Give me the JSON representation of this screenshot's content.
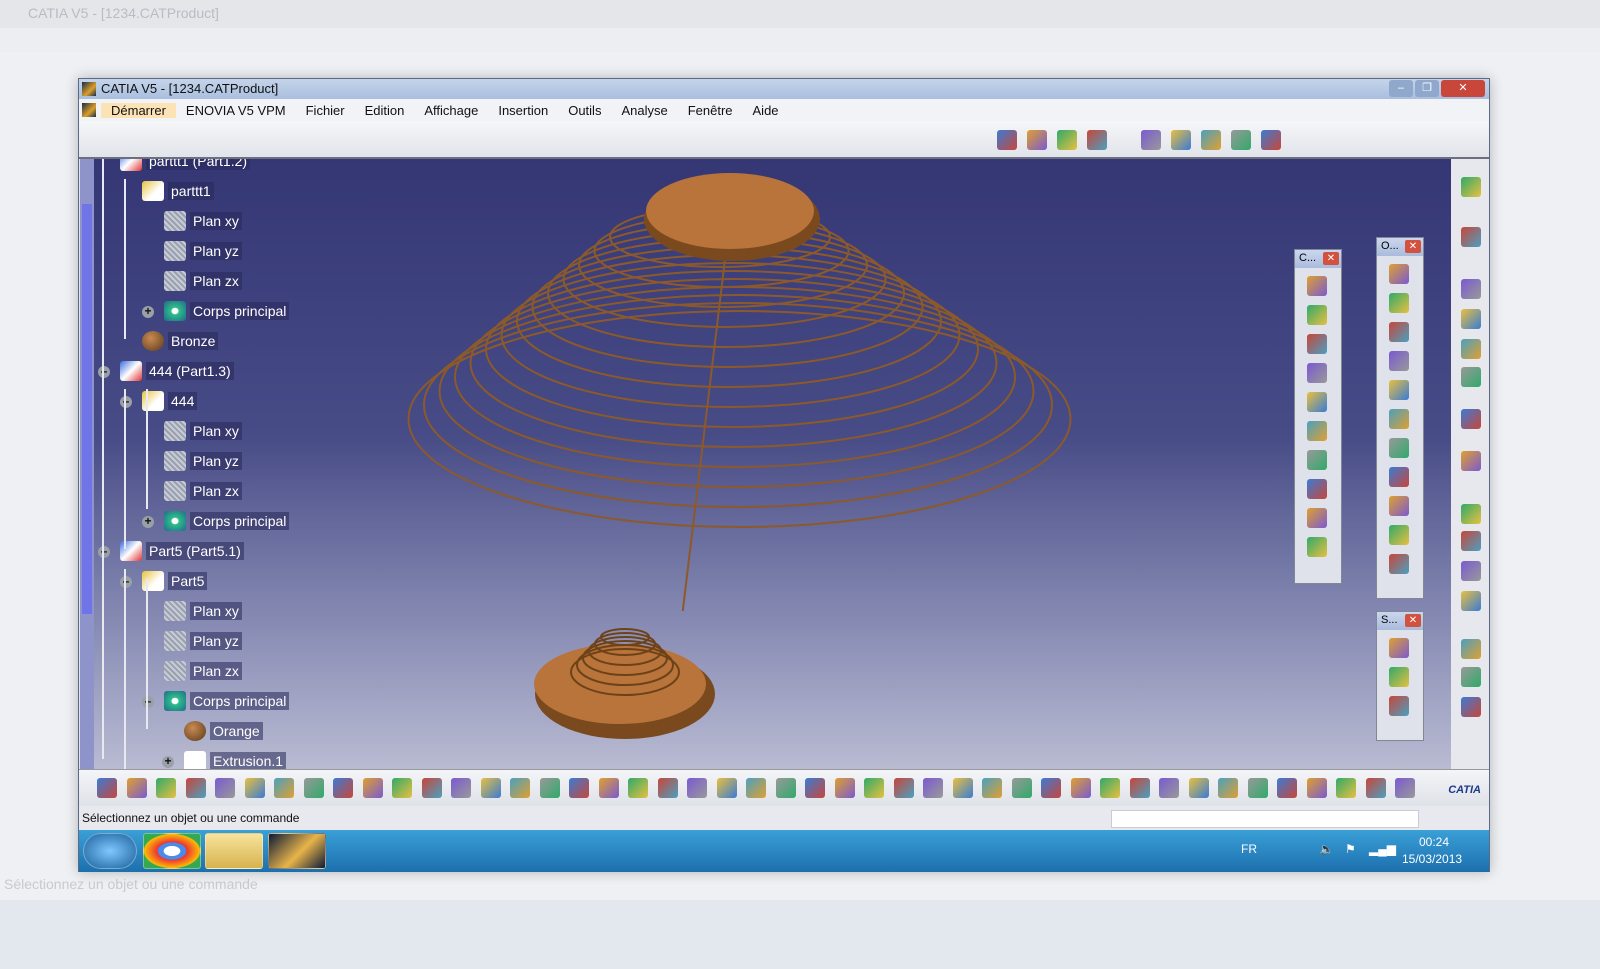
{
  "window": {
    "title": "CATIA V5 - [1234.CATProduct]"
  },
  "menu": [
    {
      "label": "Démarrer",
      "active": true
    },
    {
      "label": "ENOVIA V5 VPM"
    },
    {
      "label": "Fichier"
    },
    {
      "label": "Edition"
    },
    {
      "label": "Affichage"
    },
    {
      "label": "Insertion"
    },
    {
      "label": "Outils"
    },
    {
      "label": "Analyse"
    },
    {
      "label": "Fenêtre"
    },
    {
      "label": "Aide"
    }
  ],
  "tree": [
    {
      "label": "parttt1 (Part1.2)",
      "level": 1,
      "icon": "part-instance-icon"
    },
    {
      "label": "parttt1",
      "level": 2,
      "icon": "part-icon"
    },
    {
      "label": "Plan xy",
      "level": 3,
      "icon": "plane-icon"
    },
    {
      "label": "Plan yz",
      "level": 3,
      "icon": "plane-icon"
    },
    {
      "label": "Plan zx",
      "level": 3,
      "icon": "plane-icon"
    },
    {
      "label": "Corps principal",
      "level": 3,
      "icon": "body-gear-icon",
      "toggle": "+"
    },
    {
      "label": "Bronze",
      "level": 2,
      "icon": "material-icon"
    },
    {
      "label": "444 (Part1.3)",
      "level": 1,
      "icon": "part-instance-icon",
      "toggle": "-"
    },
    {
      "label": "444",
      "level": 2,
      "icon": "part-icon",
      "toggle": "-"
    },
    {
      "label": "Plan xy",
      "level": 3,
      "icon": "plane-icon"
    },
    {
      "label": "Plan yz",
      "level": 3,
      "icon": "plane-icon"
    },
    {
      "label": "Plan zx",
      "level": 3,
      "icon": "plane-icon"
    },
    {
      "label": "Corps principal",
      "level": 3,
      "icon": "body-gear-icon",
      "toggle": "+"
    },
    {
      "label": "Part5 (Part5.1)",
      "level": 1,
      "icon": "part-instance-icon",
      "toggle": "-"
    },
    {
      "label": "Part5",
      "level": 2,
      "icon": "part-icon",
      "toggle": "-"
    },
    {
      "label": "Plan xy",
      "level": 3,
      "icon": "plane-icon"
    },
    {
      "label": "Plan yz",
      "level": 3,
      "icon": "plane-icon"
    },
    {
      "label": "Plan zx",
      "level": 3,
      "icon": "plane-icon"
    },
    {
      "label": "Corps principal",
      "level": 3,
      "icon": "body-gear-icon",
      "toggle": "-"
    },
    {
      "label": "Orange",
      "level": 4,
      "icon": "material-icon"
    },
    {
      "label": "Extrusion.1",
      "level": 4,
      "icon": "extrusion-icon",
      "toggle": "+"
    }
  ],
  "floating_toolbars": [
    {
      "title": "C..."
    },
    {
      "title": "O..."
    },
    {
      "title": "S..."
    }
  ],
  "status": {
    "message": "Sélectionnez un objet ou une commande",
    "command_input": ""
  },
  "taskbar": {
    "lang": "FR",
    "time": "00:24",
    "date": "15/03/2013",
    "apps": [
      "start-orb",
      "chrome",
      "file-explorer",
      "catia"
    ]
  },
  "brand": "CATIA",
  "colors": {
    "viewport_top": "#343774",
    "viewport_bottom": "#b9bbd2",
    "model": "#b8743a",
    "taskbar": "#1c6fae"
  }
}
